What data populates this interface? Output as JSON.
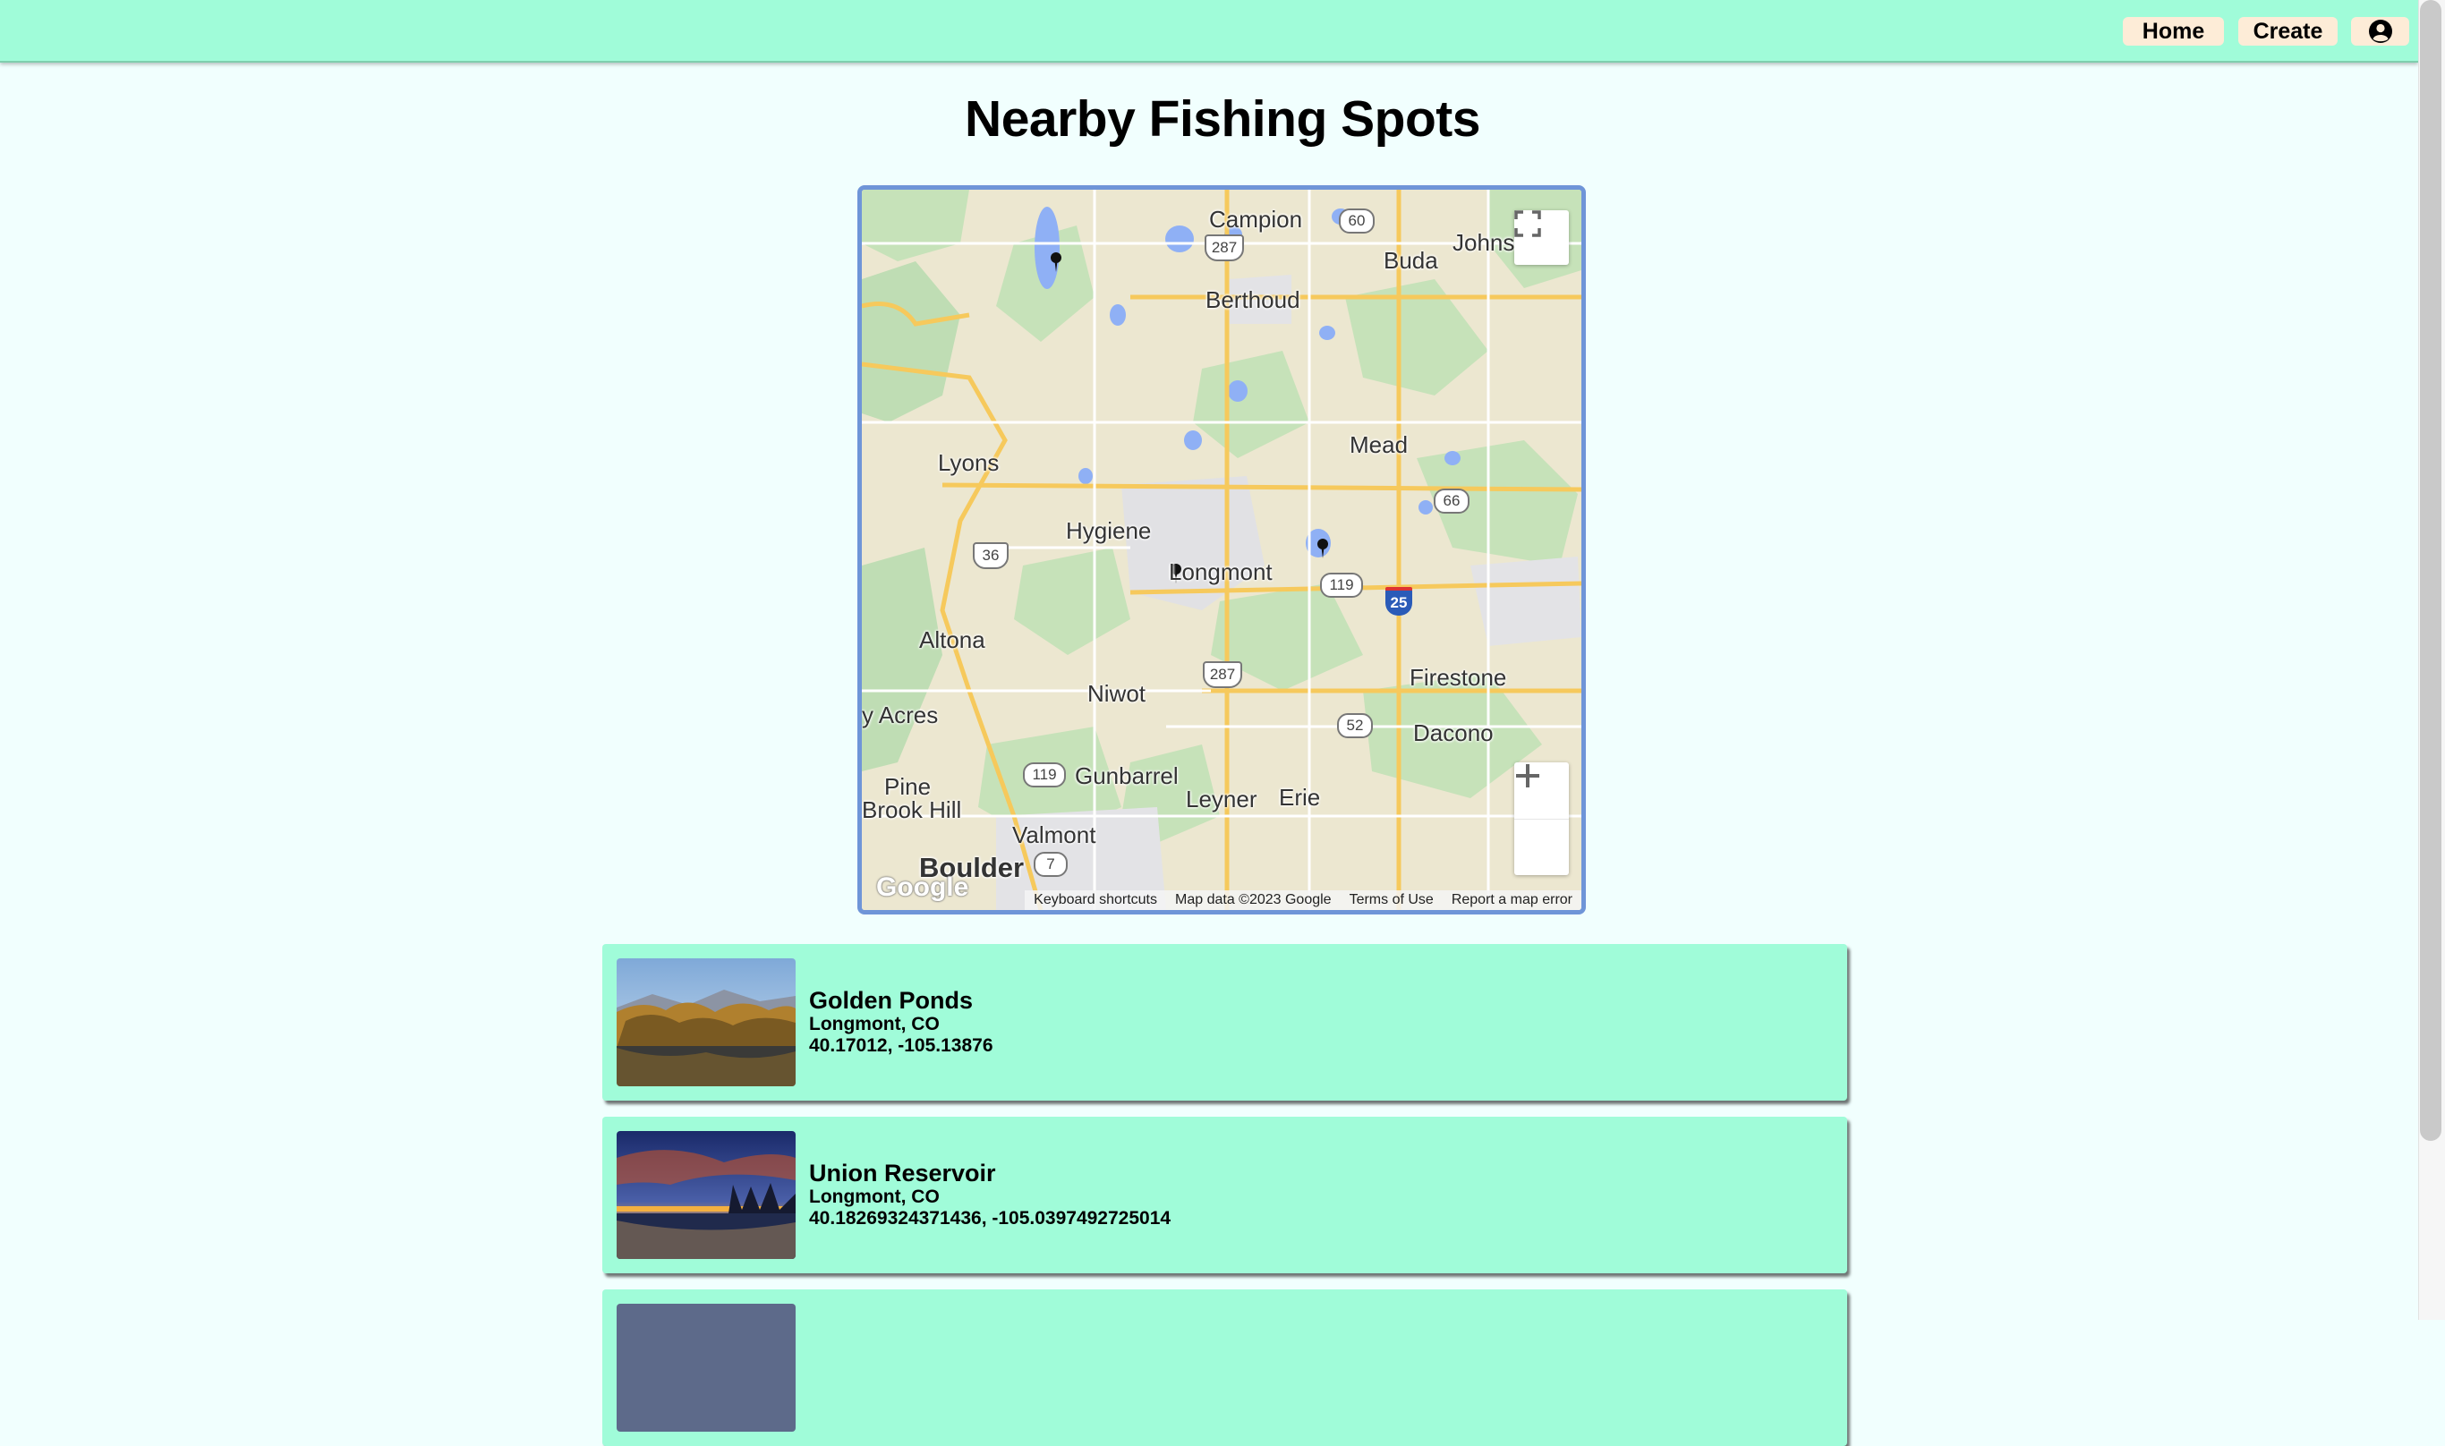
{
  "nav": {
    "home_label": "Home",
    "create_label": "Create",
    "profile_icon": "user-circle-icon"
  },
  "page": {
    "title": "Nearby Fishing Spots"
  },
  "map": {
    "labels": {
      "campion": "Campion",
      "berthoud": "Berthoud",
      "buda": "Buda",
      "johns": "Johns",
      "mead": "Mead",
      "lyons": "Lyons",
      "hygiene": "Hygiene",
      "longmont": "Longmont",
      "altona": "Altona",
      "niwot": "Niwot",
      "firestone": "Firestone",
      "dacono": "Dacono",
      "acres": "y Acres",
      "pine": "Pine",
      "brook_hill": "Brook Hill",
      "gunbarrel": "Gunbarrel",
      "leyner": "Leyner",
      "erie": "Erie",
      "valmont": "Valmont",
      "boulder": "Boulder"
    },
    "shields": {
      "r60": "60",
      "r287a": "287",
      "r66": "66",
      "r36": "36",
      "r119a": "119",
      "i25": "25",
      "r287b": "287",
      "r52": "52",
      "r119b": "119",
      "r7": "7"
    },
    "footer": {
      "shortcuts": "Keyboard shortcuts",
      "data": "Map data ©2023 Google",
      "terms": "Terms of Use",
      "report": "Report a map error"
    },
    "logo": "Google",
    "fullscreen_icon": "fullscreen-icon",
    "zoom_in_icon": "plus-icon",
    "zoom_out_icon": "minus-icon"
  },
  "spots": [
    {
      "name": "Golden Ponds",
      "location": "Longmont, CO",
      "coords": "40.17012, -105.13876"
    },
    {
      "name": "Union Reservoir",
      "location": "Longmont, CO",
      "coords": "40.18269324371436, -105.0397492725014"
    }
  ],
  "colors": {
    "accent": "#a0fcd9",
    "button": "#fdecd7",
    "map_border": "#6f95d8",
    "background": "#f1fffe"
  }
}
